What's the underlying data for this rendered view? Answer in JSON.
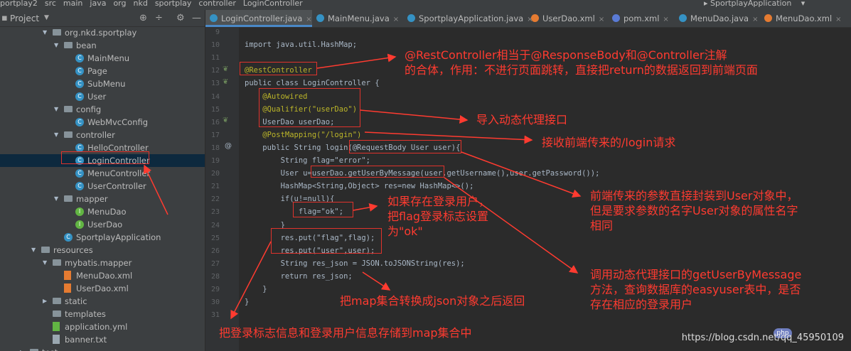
{
  "breadcrumb": [
    "portplay2",
    "src",
    "main",
    "java",
    "org",
    "nkd",
    "sportplay",
    "controller",
    "LoginController"
  ],
  "run_config": "SportplayApplication",
  "project_panel": {
    "title": "Project"
  },
  "tree": [
    {
      "label": "org.nkd.sportplay",
      "depth": 0,
      "kind": "package",
      "open": true
    },
    {
      "label": "bean",
      "depth": 1,
      "kind": "folder",
      "open": true
    },
    {
      "label": "MainMenu",
      "depth": 2,
      "kind": "class"
    },
    {
      "label": "Page",
      "depth": 2,
      "kind": "class"
    },
    {
      "label": "SubMenu",
      "depth": 2,
      "kind": "class"
    },
    {
      "label": "User",
      "depth": 2,
      "kind": "class"
    },
    {
      "label": "config",
      "depth": 1,
      "kind": "folder",
      "open": true
    },
    {
      "label": "WebMvcConfig",
      "depth": 2,
      "kind": "class"
    },
    {
      "label": "controller",
      "depth": 1,
      "kind": "folder",
      "open": true
    },
    {
      "label": "HelloController",
      "depth": 2,
      "kind": "class"
    },
    {
      "label": "LoginController",
      "depth": 2,
      "kind": "class",
      "selected": true
    },
    {
      "label": "MenuController",
      "depth": 2,
      "kind": "class"
    },
    {
      "label": "UserController",
      "depth": 2,
      "kind": "class"
    },
    {
      "label": "mapper",
      "depth": 1,
      "kind": "folder",
      "open": true
    },
    {
      "label": "MenuDao",
      "depth": 2,
      "kind": "interface"
    },
    {
      "label": "UserDao",
      "depth": 2,
      "kind": "interface"
    },
    {
      "label": "SportplayApplication",
      "depth": 1,
      "kind": "app"
    },
    {
      "label": "resources",
      "depth": -1,
      "kind": "folder",
      "open": true
    },
    {
      "label": "mybatis.mapper",
      "depth": 0,
      "kind": "folder",
      "open": true
    },
    {
      "label": "MenuDao.xml",
      "depth": 1,
      "kind": "xml"
    },
    {
      "label": "UserDao.xml",
      "depth": 1,
      "kind": "xml"
    },
    {
      "label": "static",
      "depth": 0,
      "kind": "folder",
      "open": false
    },
    {
      "label": "templates",
      "depth": 0,
      "kind": "folder"
    },
    {
      "label": "application.yml",
      "depth": 0,
      "kind": "yml"
    },
    {
      "label": "banner.txt",
      "depth": 0,
      "kind": "txt"
    },
    {
      "label": "test",
      "depth": -2,
      "kind": "folder",
      "open": false
    }
  ],
  "tabs": [
    {
      "label": "LoginController.java",
      "active": true,
      "icon_color": "#3592c4"
    },
    {
      "label": "MainMenu.java",
      "icon_color": "#3592c4"
    },
    {
      "label": "SportplayApplication.java",
      "icon_color": "#3592c4"
    },
    {
      "label": "UserDao.xml",
      "icon_color": "#e57b31"
    },
    {
      "label": "pom.xml",
      "icon_color": "#5a7bd6"
    },
    {
      "label": "MenuDao.java",
      "icon_color": "#3592c4"
    },
    {
      "label": "MenuDao.xml",
      "icon_color": "#e57b31"
    }
  ],
  "line_numbers": [
    "9",
    "10",
    "11",
    "12",
    "13",
    "14",
    "15",
    "16",
    "17",
    "18",
    "19",
    "20",
    "21",
    "22",
    "23",
    "24",
    "25",
    "26",
    "27",
    "28",
    "29",
    "30",
    "31"
  ],
  "code_lines": [
    "",
    "import java.util.HashMap;",
    "",
    "@RestController",
    "public class LoginController {",
    "    @Autowired",
    "    @Qualifier(\"userDao\")",
    "    UserDao userDao;",
    "    @PostMapping(\"/login\")",
    "    public String login(@RequestBody User user){",
    "        String flag=\"error\";",
    "        User u=userDao.getUserByMessage(user.getUsername(),user.getPassword());",
    "        HashMap<String,Object> res=new HashMap<>();",
    "        if(u!=null){",
    "            flag=\"ok\";",
    "        }",
    "        res.put(\"flag\",flag);",
    "        res.put(\"user\",user);",
    "        String res_json = JSON.toJSONString(res);",
    "        return res_json;",
    "    }",
    "}",
    ""
  ],
  "annotations": [
    {
      "lines": [
        "@RestController相当于@ResponseBody和@Controller注解",
        "的合体，作用：不进行页面跳转，直接把return的数据返回到前端页面"
      ]
    },
    {
      "lines": [
        "导入动态代理接口"
      ]
    },
    {
      "lines": [
        "接收前端传来的/login请求"
      ]
    },
    {
      "lines": [
        "前端传来的参数直接封装到User对象中，",
        "但是要求参数的名字User对象的属性名字",
        "相同"
      ]
    },
    {
      "lines": [
        "如果存在登录用户，",
        "把flag登录标志设置",
        "为\"ok\""
      ]
    },
    {
      "lines": [
        "调用动态代理接口的getUserByMessage",
        "方法，查询数据库的easyuser表中，是否",
        "存在相应的登录用户"
      ]
    },
    {
      "lines": [
        "把map集合转换成json对象之后返回"
      ]
    },
    {
      "lines": [
        "把登录标志信息和登录用户信息存储到map集合中"
      ]
    }
  ],
  "watermark": "https://blog.csdn.net/qq_45950109",
  "php_badge": "php",
  "colors": {
    "annotation": "#ff3b30",
    "editor_bg": "#2b2b2b",
    "sidebar_bg": "#3c3f41",
    "selection": "#0d293e"
  }
}
